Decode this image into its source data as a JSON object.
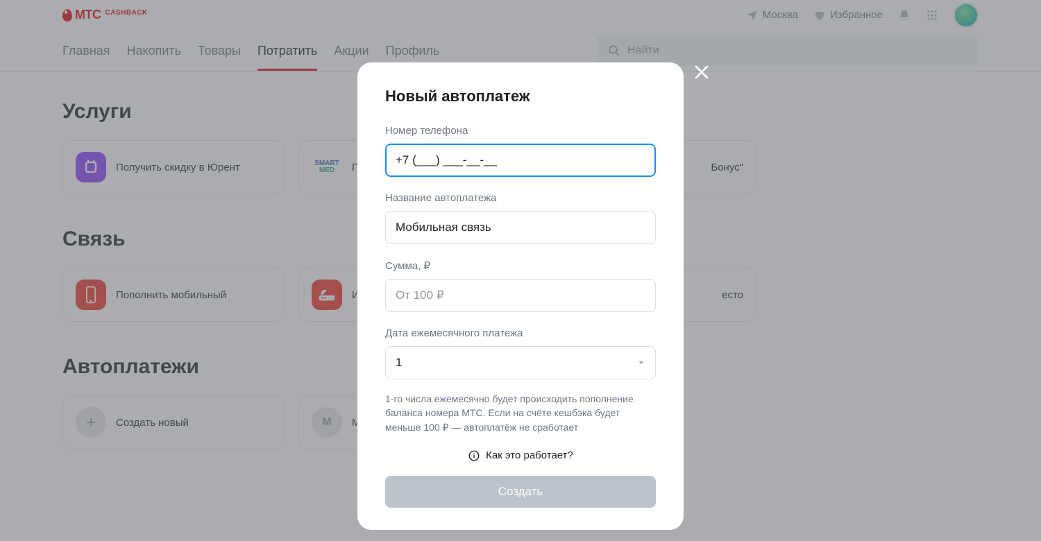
{
  "header": {
    "logo_text": "МТС",
    "logo_cash": "CASHBACK",
    "city": "Москва",
    "favorites": "Избранное"
  },
  "nav": {
    "items": [
      "Главная",
      "Накопить",
      "Товары",
      "Потратить",
      "Акции",
      "Профиль"
    ],
    "active_index": 3
  },
  "search": {
    "placeholder": "Найти"
  },
  "sections": {
    "services": {
      "title": "Услуги",
      "card1": "Получить скидку в Юрент",
      "card2_line": "Получить скидку на Sma",
      "card3_suffix": "Бонус\""
    },
    "comms": {
      "title": "Связь",
      "card1": "Пополнить мобильный",
      "card2": "Инте",
      "card3_suffix": "есто"
    },
    "autopay": {
      "title": "Автоплатежи",
      "card1": "Создать новый",
      "card2_badge": "М",
      "card2_text": "М"
    }
  },
  "modal": {
    "title": "Новый автоплатеж",
    "phone_label": "Номер телефона",
    "phone_value": "+7 (___) ___-__-__",
    "name_label": "Название автоплатежа",
    "name_value": "Мобильная связь",
    "amount_label": "Сумма, ₽",
    "amount_placeholder": "От 100 ₽",
    "date_label": "Дата ежемесячного платежа",
    "date_value": "1",
    "note": "1-го числа ежемесячно будет происходить пополнение баланса номера МТС. Если на счёте кешбэка будет меньше 100 ₽ — автоплатёж не сработает",
    "how_link": "Как это работает?",
    "create_button": "Создать"
  }
}
